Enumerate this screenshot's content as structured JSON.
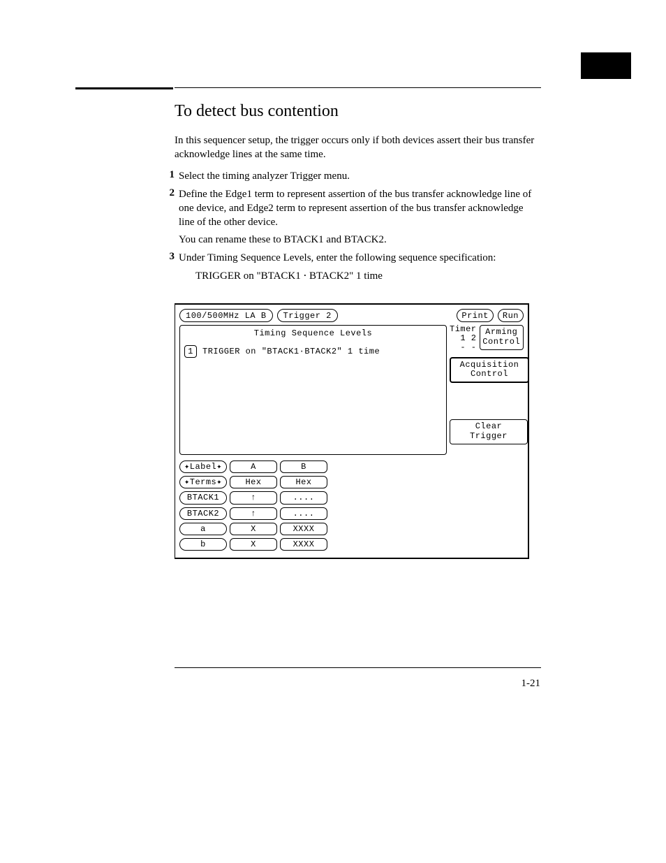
{
  "page": {
    "title": "To detect bus contention",
    "intro": "In this sequencer setup, the trigger occurs only if both devices assert their bus transfer acknowledge lines at the same time.",
    "page_number": "1-21"
  },
  "steps": [
    {
      "num": "1",
      "main": "Select the timing analyzer Trigger menu.",
      "note": ""
    },
    {
      "num": "2",
      "main": "Define the Edge1 term to represent assertion of the bus transfer acknowledge line of one device, and Edge2 term to represent assertion of the bus transfer acknowledge line of the other device.",
      "note": "You can rename these to BTACK1 and BTACK2."
    },
    {
      "num": "3",
      "main": "Under Timing Sequence Levels, enter the following sequence specification:",
      "note": ""
    }
  ],
  "trigger_spec": "TRIGGER on \"BTACK1 ⋅ BTACK2\" 1 time",
  "la": {
    "top_left": [
      "100/500MHz LA B",
      "Trigger 2"
    ],
    "top_right": [
      "Print",
      "Run"
    ],
    "tsl_title": "Timing Sequence Levels",
    "tsl_step": "1",
    "tsl_text": "TRIGGER on \"BTACK1·BTACK2\"  1 time",
    "timer_label": "Timer\n1 2\n- -",
    "side_buttons": [
      "Arming\nControl",
      "Acquisition\nControl",
      "Clear\nTrigger"
    ],
    "table": {
      "row_header_1": "✦Label✦",
      "row_header_2": "✦Terms✦",
      "cols": [
        "A",
        "B"
      ],
      "format": [
        "Hex",
        "Hex"
      ],
      "rows": [
        {
          "name": "BTACK1",
          "vals": [
            "↑",
            "...."
          ]
        },
        {
          "name": "BTACK2",
          "vals": [
            "↑",
            "...."
          ]
        },
        {
          "name": "a",
          "vals": [
            "X",
            "XXXX"
          ]
        },
        {
          "name": "b",
          "vals": [
            "X",
            "XXXX"
          ]
        }
      ]
    }
  }
}
